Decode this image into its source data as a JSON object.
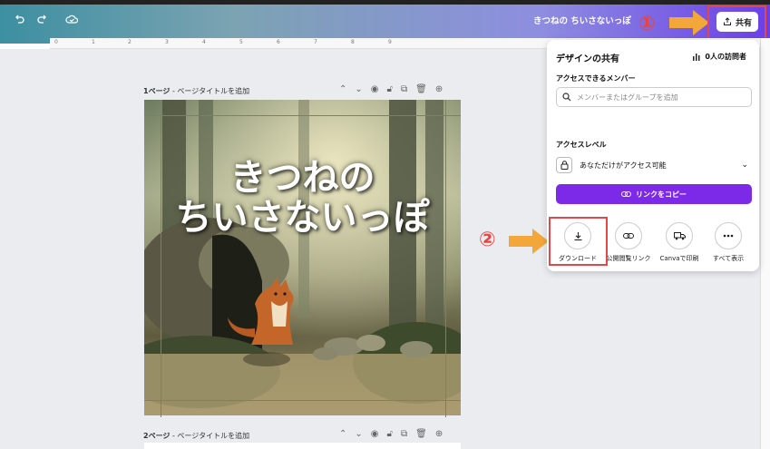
{
  "header": {
    "doc_title": "きつねの ちいさないっぽ",
    "share_label": "共有",
    "annotation_1": "①",
    "annotation_2": "②"
  },
  "ruler": {
    "ticks": [
      "0",
      "1",
      "2",
      "3",
      "4",
      "5",
      "6",
      "7",
      "8",
      "9"
    ]
  },
  "pages": [
    {
      "number_label": "1ページ",
      "title_placeholder": "ページタイトルを追加"
    },
    {
      "number_label": "2ページ",
      "title_placeholder": "ページタイトルを追加"
    }
  ],
  "artwork": {
    "title_line1": "きつねの",
    "title_line2": "ちいさないっぽ"
  },
  "share_panel": {
    "title": "デザインの共有",
    "visitors": "0人の訪問者",
    "members_label": "アクセスできるメンバー",
    "search_placeholder": "メンバーまたはグループを追加",
    "access_level_label": "アクセスレベル",
    "access_value": "あなただけがアクセス可能",
    "copy_link": "リンクをコピー",
    "actions": [
      "ダウンロード",
      "公開閲覧リンク",
      "Canvaで印刷",
      "すべて表示"
    ]
  },
  "colors": {
    "accent": "#7d2ae8",
    "annotation": "#e8443f",
    "arrow": "#f3a73a"
  }
}
